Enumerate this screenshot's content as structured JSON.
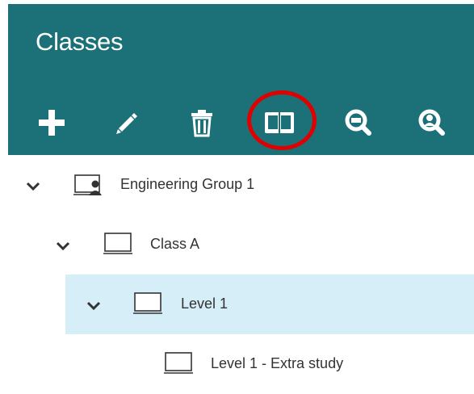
{
  "header": {
    "title": "Classes",
    "toolbar": [
      {
        "id": "add",
        "icon": "plus-icon"
      },
      {
        "id": "edit",
        "icon": "pencil-icon"
      },
      {
        "id": "delete",
        "icon": "trash-icon"
      },
      {
        "id": "book",
        "icon": "open-book-icon",
        "highlighted": true
      },
      {
        "id": "search",
        "icon": "magnifier-icon"
      },
      {
        "id": "search-user",
        "icon": "user-search-icon"
      }
    ]
  },
  "tree": {
    "items": [
      {
        "label": "Engineering Group 1",
        "icon": "group-monitor-icon",
        "expanded": true,
        "selected": false
      },
      {
        "label": "Class A",
        "icon": "monitor-icon",
        "expanded": true,
        "selected": false
      },
      {
        "label": "Level 1",
        "icon": "monitor-icon",
        "expanded": true,
        "selected": true
      },
      {
        "label": "Level 1 - Extra study",
        "icon": "monitor-icon",
        "expanded": false,
        "selected": false
      }
    ]
  },
  "colors": {
    "header_bg": "#1c7078",
    "highlight_ring": "#e10000",
    "selected_row_bg": "#d6eef8",
    "text": "#333333"
  }
}
